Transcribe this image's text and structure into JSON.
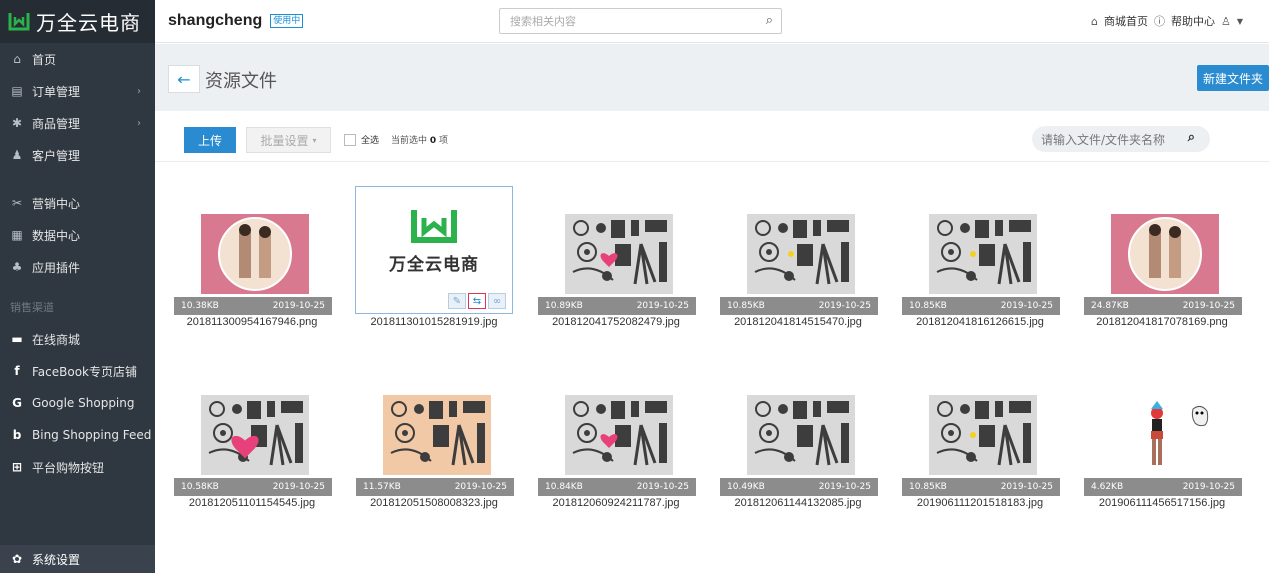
{
  "brand": {
    "name": "万全云电商",
    "color": "#2bb24c"
  },
  "sidebar": {
    "items": [
      {
        "label": "首页",
        "icon": "home-icon",
        "chev": false
      },
      {
        "label": "订单管理",
        "icon": "order-icon",
        "chev": true
      },
      {
        "label": "商品管理",
        "icon": "goods-icon",
        "chev": true
      },
      {
        "label": "客户管理",
        "icon": "customer-icon",
        "chev": false
      }
    ],
    "items2": [
      {
        "label": "营销中心",
        "icon": "marketing-icon"
      },
      {
        "label": "数据中心",
        "icon": "data-icon"
      },
      {
        "label": "应用插件",
        "icon": "plugin-icon"
      }
    ],
    "section_label": "销售渠道",
    "channels": [
      {
        "label": "在线商城",
        "icon": "store-icon"
      },
      {
        "label": "FaceBook专页店铺",
        "icon": "facebook-icon"
      },
      {
        "label": "Google Shopping",
        "icon": "google-icon"
      },
      {
        "label": "Bing Shopping Feed",
        "icon": "bing-icon"
      },
      {
        "label": "平台购物按钮",
        "icon": "cart-button-icon"
      }
    ],
    "settings_label": "系统设置"
  },
  "topbar": {
    "store_name": "shangcheng",
    "store_badge": "使用中",
    "search_placeholder": "搜索相关内容",
    "mall_home": "商城首页",
    "help_center": "帮助中心"
  },
  "header": {
    "back": "←",
    "title": "资源文件",
    "new_folder": "新建文件夹"
  },
  "toolbar": {
    "upload": "上传",
    "batch": "批量设置",
    "select_all": "全选",
    "selected_prefix": "当前选中",
    "selected_count": "0",
    "selected_suffix": "项",
    "search_placeholder": "请输入文件/文件夹名称"
  },
  "files": [
    {
      "size": "10.38KB",
      "date": "2019-10-25",
      "name": "201811300954167946.png",
      "kind": "girl-pink"
    },
    {
      "size": "",
      "date": "",
      "name": "201811301015281919.jpg",
      "kind": "logo"
    },
    {
      "size": "10.89KB",
      "date": "2019-10-25",
      "name": "201812041752082479.jpg",
      "kind": "camera-heart"
    },
    {
      "size": "10.85KB",
      "date": "2019-10-25",
      "name": "201812041814515470.jpg",
      "kind": "camera-yellow"
    },
    {
      "size": "10.85KB",
      "date": "2019-10-25",
      "name": "201812041816126615.jpg",
      "kind": "camera-yellow"
    },
    {
      "size": "24.87KB",
      "date": "2019-10-25",
      "name": "201812041817078169.png",
      "kind": "girl-pink"
    },
    {
      "size": "10.58KB",
      "date": "2019-10-25",
      "name": "201812051101154545.jpg",
      "kind": "camera-heart-big"
    },
    {
      "size": "11.57KB",
      "date": "2019-10-25",
      "name": "201812051508008323.jpg",
      "kind": "camera-beige"
    },
    {
      "size": "10.84KB",
      "date": "2019-10-25",
      "name": "201812060924211787.jpg",
      "kind": "camera-heart"
    },
    {
      "size": "10.49KB",
      "date": "2019-10-25",
      "name": "201812061144132085.jpg",
      "kind": "camera"
    },
    {
      "size": "10.85KB",
      "date": "2019-10-25",
      "name": "201906111201518183.jpg",
      "kind": "camera-yellow"
    },
    {
      "size": "4.62KB",
      "date": "2019-10-25",
      "name": "201906111456517156.jpg",
      "kind": "person-ghost"
    }
  ],
  "selected_file_actions": [
    "edit-icon",
    "replace-icon",
    "link-icon"
  ]
}
